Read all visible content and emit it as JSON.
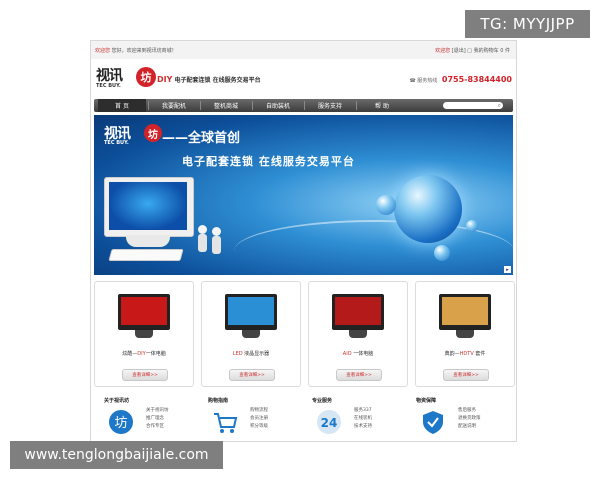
{
  "watermarks": {
    "top": "TG: MYYJJPP",
    "bottom": "www.tenglongbaijiale.com"
  },
  "topbar": {
    "left_prefix": "欢迎您",
    "left_text": "您好，欢迎来到视讯坊商城！",
    "right_login": "欢迎您",
    "right_logout": "[退出]",
    "right_cart": "我的购物车",
    "right_count": "0 件"
  },
  "header": {
    "logo_cn": "视讯",
    "logo_seal": "坊",
    "logo_en": "TEC BUY.",
    "slogan_diy": "DIY",
    "slogan_text": "电子配套连锁 在线服务交易平台",
    "phone_label": "服务热线",
    "phone_number": "0755-83844400"
  },
  "nav": {
    "items": [
      {
        "label": "首 页"
      },
      {
        "label": "我要配机"
      },
      {
        "label": "整机商城"
      },
      {
        "label": "自助装机"
      },
      {
        "label": "服务支持"
      },
      {
        "label": "帮 助"
      }
    ],
    "search_icon": "search-icon"
  },
  "banner": {
    "logo_cn": "视讯",
    "logo_seal": "坊",
    "logo_en": "TEC BUY.",
    "headline": "——全球首创",
    "subheadline": "电子配套连锁  在线服务交易平台"
  },
  "products": [
    {
      "name_pre": "炫酷—",
      "name_hl": "DIY",
      "name_post": "一体电脑",
      "button": "查看详细>>",
      "screen_color": "#c81818"
    },
    {
      "name_pre": "",
      "name_hl": "LED",
      "name_post": " 液晶显示器",
      "button": "查看详细>>",
      "screen_color": "#2b8fd6"
    },
    {
      "name_pre": "",
      "name_hl": "AIO",
      "name_post": " 一体电脑",
      "button": "查看详细>>",
      "screen_color": "#b51a1a"
    },
    {
      "name_pre": "典韵—",
      "name_hl": "HDTV",
      "name_post": " 套件",
      "button": "查看详细>>",
      "screen_color": "#d9a24a"
    }
  ],
  "footer": [
    {
      "title": "关于视讯坊",
      "links": [
        "关于视讯坊",
        "推广理念",
        "合作专区"
      ],
      "icon": "logo-seal-icon"
    },
    {
      "title": "购物指南",
      "links": [
        "购物流程",
        "会员注册",
        "积分等级"
      ],
      "icon": "shopping-cart-icon"
    },
    {
      "title": "专业服务",
      "links": [
        "服务337",
        "在线装机",
        "技术支持"
      ],
      "icon": "24-hour-icon"
    },
    {
      "title": "物资保障",
      "links": [
        "售后服务",
        "退换货政策",
        "配送说明"
      ],
      "icon": "shield-icon"
    }
  ]
}
